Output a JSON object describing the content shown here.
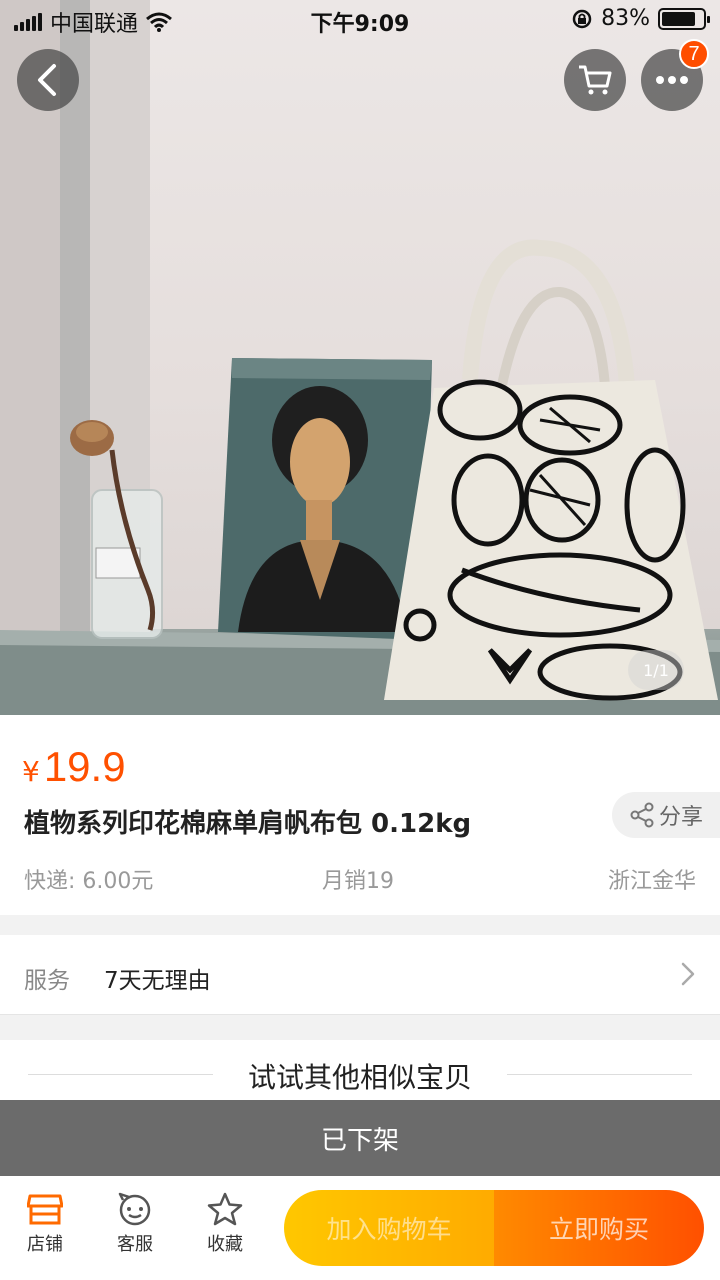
{
  "status_bar": {
    "carrier": "中国联通",
    "time": "下午9:09",
    "battery": "83%",
    "battery_level": 0.83
  },
  "header": {
    "cart_badge": "7",
    "image_counter": "1/1"
  },
  "product": {
    "currency": "¥",
    "price": "19.9",
    "title": "植物系列印花棉麻单肩帆布包 0.12kg",
    "share_label": "分享",
    "shipping": "快递: 6.00元",
    "monthly_sales": "月销19",
    "location": "浙江金华"
  },
  "service": {
    "label": "服务",
    "value": "7天无理由"
  },
  "similar": {
    "title": "试试其他相似宝贝"
  },
  "off_shelf": "已下架",
  "bottom_bar": {
    "shop": "店铺",
    "support": "客服",
    "favorite": "收藏",
    "add_to_cart": "加入购物车",
    "buy_now": "立即购买"
  },
  "colors": {
    "accent": "#ff5000",
    "cart_button": "#ffc700",
    "buy_button": "#ff5000",
    "off_shelf_bar": "#6b6b6b"
  }
}
